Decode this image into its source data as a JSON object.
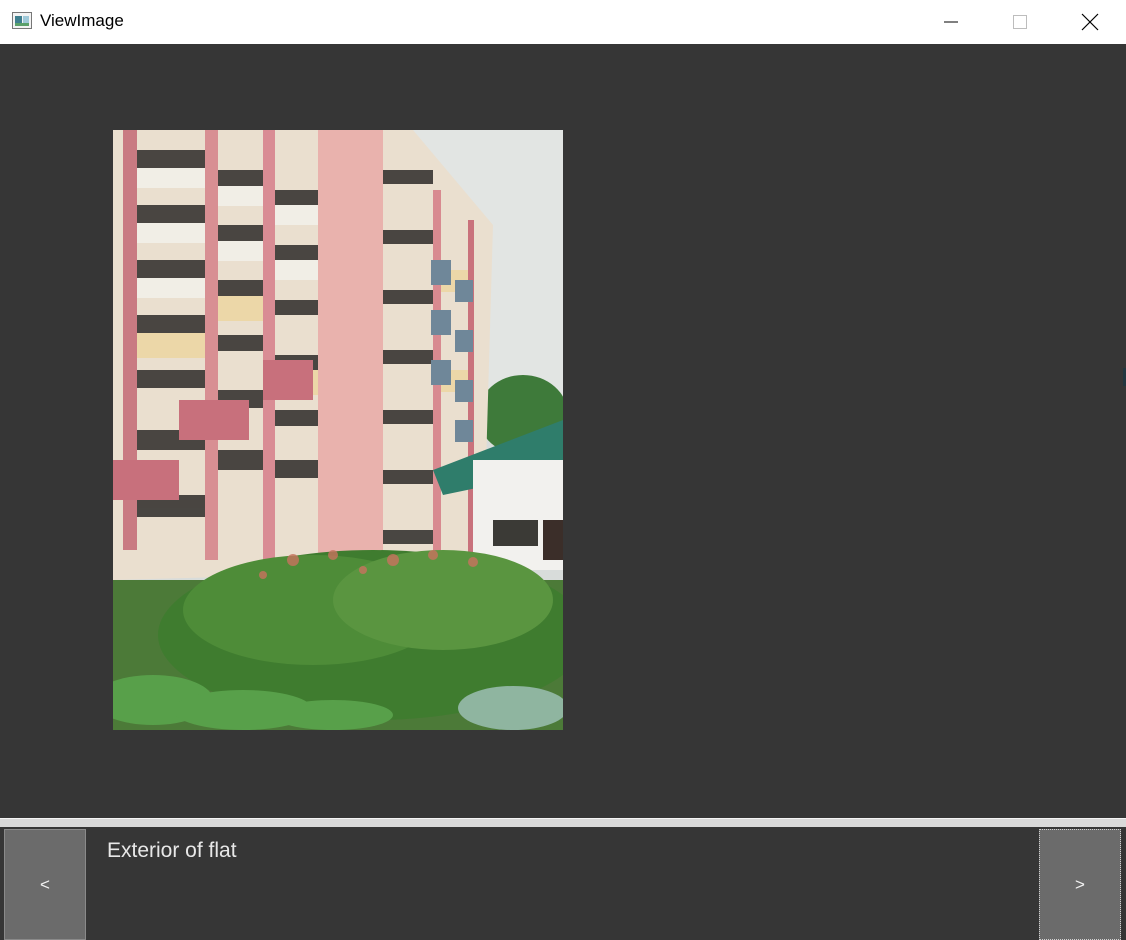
{
  "window": {
    "title": "ViewImage",
    "icon": "app-image-icon",
    "controls": [
      "minimize-icon",
      "maximize-icon",
      "close-icon"
    ]
  },
  "viewer": {
    "image": {
      "subject": "Exterior of flat"
    }
  },
  "caption": {
    "text": "Exterior of flat"
  },
  "nav": {
    "prev_label": "<",
    "next_label": ">"
  },
  "colors": {
    "background": "#363636",
    "button": "#6b6b6b",
    "titlebar": "#ffffff",
    "caption_text": "#e8e8e8"
  }
}
